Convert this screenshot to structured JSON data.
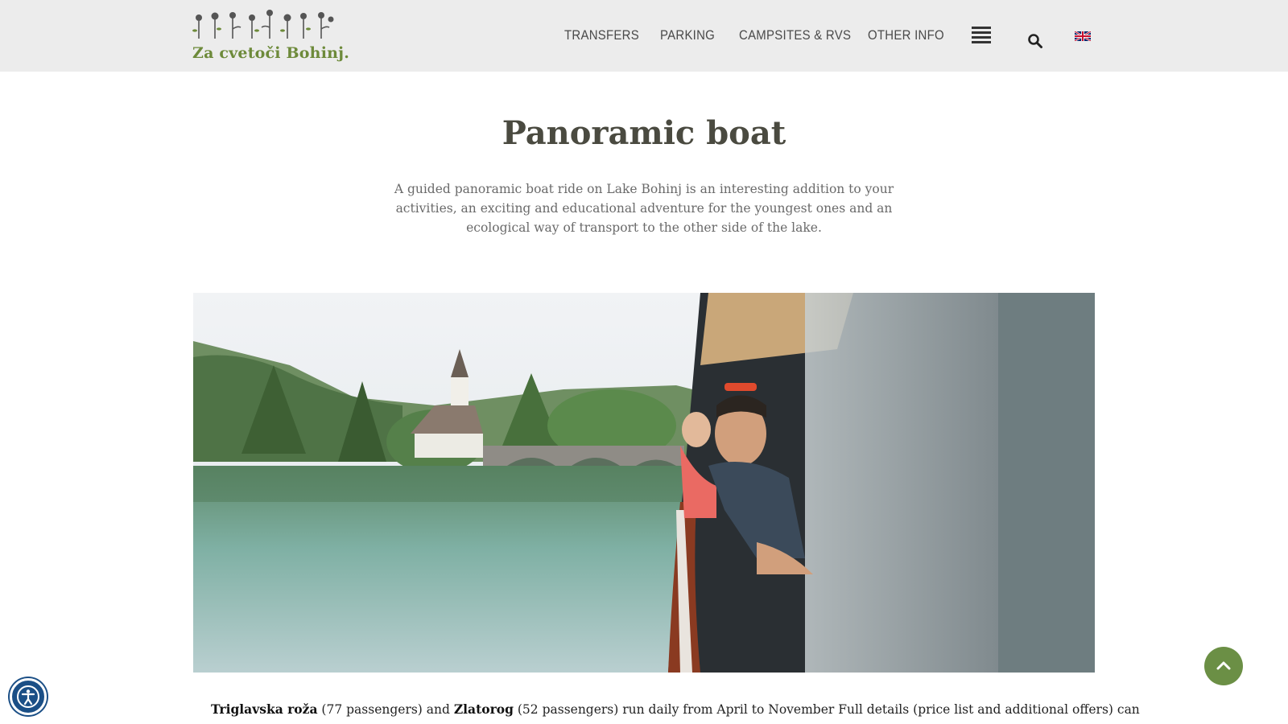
{
  "header": {
    "logo_text": "Za cvetoči Bohinj.",
    "nav": {
      "transfers": "TRANSFERS",
      "parking": "PARKING",
      "campsites": "CAMPSITES & RVS",
      "other_info": "OTHER INFO"
    },
    "icons": {
      "menu": "hamburger-menu-icon",
      "search": "search-icon",
      "language": "uk-flag-icon"
    }
  },
  "main": {
    "title": "Panoramic boat",
    "intro": "A guided panoramic boat ride on Lake Bohinj is an interesting addition to your activities, an exciting and educational adventure for the youngest ones and an ecological way of transport to the other side of the lake.",
    "body": {
      "boat1_name": "Triglavska roža",
      "boat1_info": " (77 passengers) and ",
      "boat2_name": "Zlatorog",
      "boat2_info": " (52 passengers) run daily from April to November Full details (price list and additional offers) can"
    }
  },
  "floating": {
    "scroll_top_icon": "chevron-up-icon",
    "accessibility_icon": "accessibility-icon"
  },
  "colors": {
    "header_bg": "#ececec",
    "brand_green": "#6b8f45",
    "accessibility_blue": "#1b4f86"
  }
}
